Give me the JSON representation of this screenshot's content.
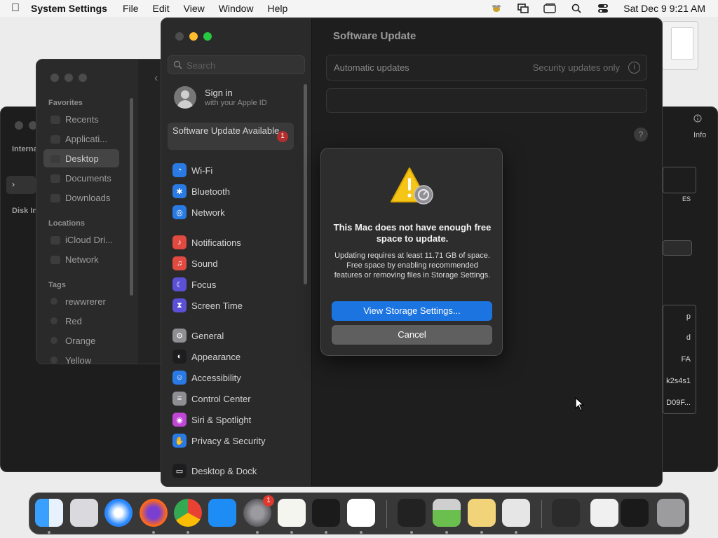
{
  "menubar": {
    "app_name": "System Settings",
    "menus": [
      "File",
      "Edit",
      "View",
      "Window",
      "Help"
    ],
    "clock": "Sat Dec 9  9:21 AM",
    "status_icons": [
      "bee-icon",
      "screen-share-icon",
      "display-icon",
      "search-icon",
      "control-center-icon"
    ]
  },
  "finder": {
    "favorites_heading": "Favorites",
    "favorites": [
      "Recents",
      "Applicati...",
      "Desktop",
      "Documents",
      "Downloads"
    ],
    "locations_heading": "Locations",
    "locations": [
      "iCloud Dri...",
      "Network"
    ],
    "tags_heading": "Tags",
    "tags": [
      "rewwrerer",
      "Red",
      "Orange",
      "Yellow"
    ]
  },
  "disk_utility": {
    "internal_label": "Interna",
    "disk_images_label": "Disk In",
    "info_label": "Info",
    "right_fragments": [
      "ES",
      "p",
      "d",
      "FA",
      "k2s4s1",
      "D09F..."
    ]
  },
  "settings": {
    "search_placeholder": "Search",
    "signin_title": "Sign in",
    "signin_subtitle": "with your Apple ID",
    "update_available": "Software Update Available",
    "update_badge": "1",
    "sidebar_groups": [
      [
        {
          "label": "Wi-Fi",
          "icon": "wifi-icon",
          "color": "#2a7ae4"
        },
        {
          "label": "Bluetooth",
          "icon": "bluetooth-icon",
          "color": "#2a7ae4"
        },
        {
          "label": "Network",
          "icon": "globe-icon",
          "color": "#2a7ae4"
        }
      ],
      [
        {
          "label": "Notifications",
          "icon": "bell-icon",
          "color": "#e04a40"
        },
        {
          "label": "Sound",
          "icon": "speaker-icon",
          "color": "#e04a40"
        },
        {
          "label": "Focus",
          "icon": "moon-icon",
          "color": "#5b50d6"
        },
        {
          "label": "Screen Time",
          "icon": "hourglass-icon",
          "color": "#5b50d6"
        }
      ],
      [
        {
          "label": "General",
          "icon": "gear-icon",
          "color": "#8e8e93"
        },
        {
          "label": "Appearance",
          "icon": "appearance-icon",
          "color": "#1d1d1f"
        },
        {
          "label": "Accessibility",
          "icon": "accessibility-icon",
          "color": "#2a7ae4"
        },
        {
          "label": "Control Center",
          "icon": "control-center-icon",
          "color": "#8e8e93"
        },
        {
          "label": "Siri & Spotlight",
          "icon": "siri-icon",
          "color": "#c046d6"
        },
        {
          "label": "Privacy & Security",
          "icon": "hand-icon",
          "color": "#2a7ae4"
        }
      ],
      [
        {
          "label": "Desktop & Dock",
          "icon": "dock-icon",
          "color": "#1d1d1f"
        }
      ]
    ],
    "page_title": "Software Update",
    "automatic_updates_label": "Automatic updates",
    "automatic_updates_value": "Security updates only",
    "help_label": "?"
  },
  "alert": {
    "icon": "warning-icon",
    "headline": "This Mac does not have enough free space to update.",
    "body": "Updating requires at least 11.71 GB of space. Free space by enabling recommended features or removing files in Storage Settings.",
    "primary_button": "View Storage Settings...",
    "secondary_button": "Cancel",
    "primary_color": "#1c74e0"
  },
  "dock": {
    "apps": [
      {
        "name": "finder-icon",
        "running": true
      },
      {
        "name": "launchpad-icon",
        "running": false
      },
      {
        "name": "safari-icon",
        "running": false
      },
      {
        "name": "firefox-icon",
        "running": true
      },
      {
        "name": "chrome-icon",
        "running": true
      },
      {
        "name": "app-store-icon",
        "running": false
      },
      {
        "name": "system-settings-icon",
        "running": true,
        "badge": "1"
      },
      {
        "name": "textedit-icon",
        "running": true
      },
      {
        "name": "terminal-icon",
        "running": true
      },
      {
        "name": "vscode-icon",
        "running": true
      },
      {
        "name": "activity-monitor-icon",
        "running": true
      },
      {
        "name": "disk-utility-icon",
        "running": true
      },
      {
        "name": "bee-app-icon",
        "running": true
      },
      {
        "name": "system-info-icon",
        "running": true
      }
    ]
  }
}
